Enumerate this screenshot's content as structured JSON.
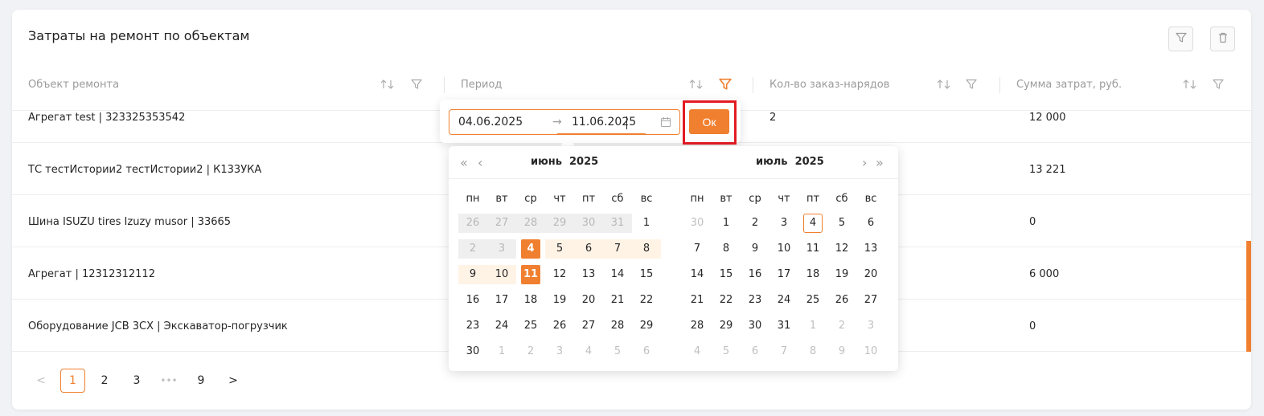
{
  "title": "Затраты на ремонт по объектам",
  "columns": [
    {
      "label": "Объект ремонта"
    },
    {
      "label": "Период"
    },
    {
      "label": "Кол-во заказ-нарядов"
    },
    {
      "label": "Сумма затрат, руб."
    }
  ],
  "rows": [
    {
      "object": "Агрегат test | 323325353542",
      "count": "2",
      "sum": "12 000"
    },
    {
      "object": "ТС тестИстории2 тестИстории2 | К133УКА",
      "count": "",
      "sum": "13 221"
    },
    {
      "object": "Шина ISUZU tires Izuzy musor | 33665",
      "count": "",
      "sum": "0"
    },
    {
      "object": "Агрегат | 12312312112",
      "count": "",
      "sum": "6 000"
    },
    {
      "object": "Оборудование JCB 3CX | Экскаватор-погрузчик",
      "count": "",
      "sum": "0"
    }
  ],
  "pagination": {
    "prev": "<",
    "next": ">",
    "pages": [
      "1",
      "2",
      "3",
      "•••",
      "9"
    ],
    "active": "1"
  },
  "range": {
    "start": "04.06.2025",
    "end": "11.06.2025",
    "separator": "→",
    "ok_label": "Ок"
  },
  "calendar": {
    "nav": {
      "prev_year": "«",
      "prev_month": "‹",
      "next_month": "›",
      "next_year": "»"
    },
    "weekdays": [
      "пн",
      "вт",
      "ср",
      "чт",
      "пт",
      "сб",
      "вс"
    ],
    "left": {
      "month": "июнь",
      "year": "2025",
      "weeks": [
        [
          "26",
          "27",
          "28",
          "29",
          "30",
          "31",
          "1"
        ],
        [
          "2",
          "3",
          "4",
          "5",
          "6",
          "7",
          "8"
        ],
        [
          "9",
          "10",
          "11",
          "12",
          "13",
          "14",
          "15"
        ],
        [
          "16",
          "17",
          "18",
          "19",
          "20",
          "21",
          "22"
        ],
        [
          "23",
          "24",
          "25",
          "26",
          "27",
          "28",
          "29"
        ],
        [
          "30",
          "1",
          "2",
          "3",
          "4",
          "5",
          "6"
        ]
      ]
    },
    "right": {
      "month": "июль",
      "year": "2025",
      "weeks": [
        [
          "30",
          "1",
          "2",
          "3",
          "4",
          "5",
          "6"
        ],
        [
          "7",
          "8",
          "9",
          "10",
          "11",
          "12",
          "13"
        ],
        [
          "14",
          "15",
          "16",
          "17",
          "18",
          "19",
          "20"
        ],
        [
          "21",
          "22",
          "23",
          "24",
          "25",
          "26",
          "27"
        ],
        [
          "28",
          "29",
          "30",
          "31",
          "1",
          "2",
          "3"
        ],
        [
          "4",
          "5",
          "6",
          "7",
          "8",
          "9",
          "10"
        ]
      ]
    },
    "selected_start": "4",
    "selected_end": "11",
    "today_in_right": "4"
  },
  "colors": {
    "accent": "#f07f2f",
    "highlight": "#e21b23"
  }
}
